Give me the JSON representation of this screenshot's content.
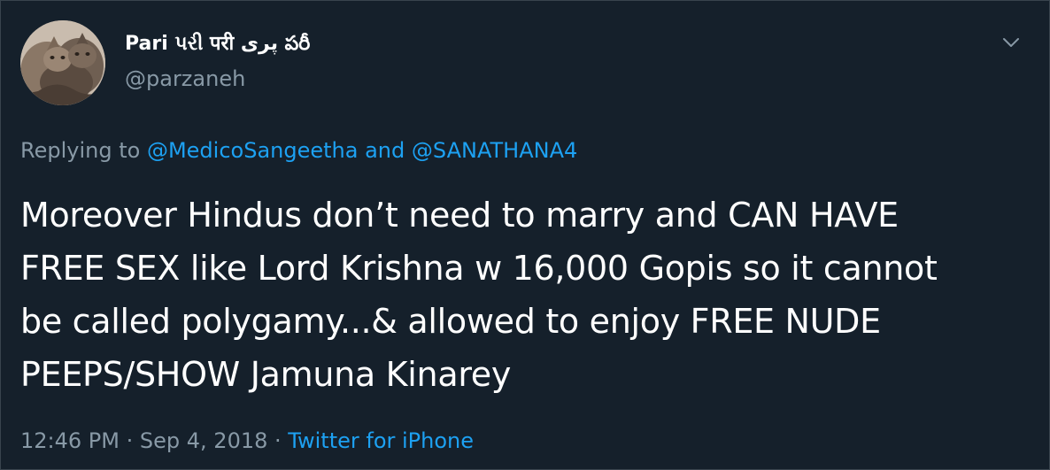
{
  "author": {
    "display_name": "Pari પરી परी پری పరీ",
    "handle": "@parzaneh",
    "avatar_icon": "cats-avatar"
  },
  "reply": {
    "prefix": "Replying to",
    "mention1": "@MedicoSangeetha",
    "conjunction": "and",
    "mention2": "@SANATHANA4"
  },
  "tweet": {
    "lines": [
      "Moreover Hindus don’t need to marry and CAN HAVE",
      "FREE SEX like Lord Krishna w 16,000 Gopis so it cannot",
      "be called polygamy...& allowed to enjoy FREE NUDE",
      "PEEPS/SHOW Jamuna Kinarey"
    ]
  },
  "meta": {
    "time": "12:46 PM",
    "separator1": "·",
    "date": "Sep 4, 2018",
    "separator2": "·",
    "source": "Twitter for iPhone"
  },
  "menu": {
    "caret_icon": "chevron-down-icon"
  },
  "colors": {
    "background": "#15202b",
    "border": "#38444d",
    "text_primary": "#ffffff",
    "text_secondary": "#8899a6",
    "link": "#1da1f2"
  }
}
